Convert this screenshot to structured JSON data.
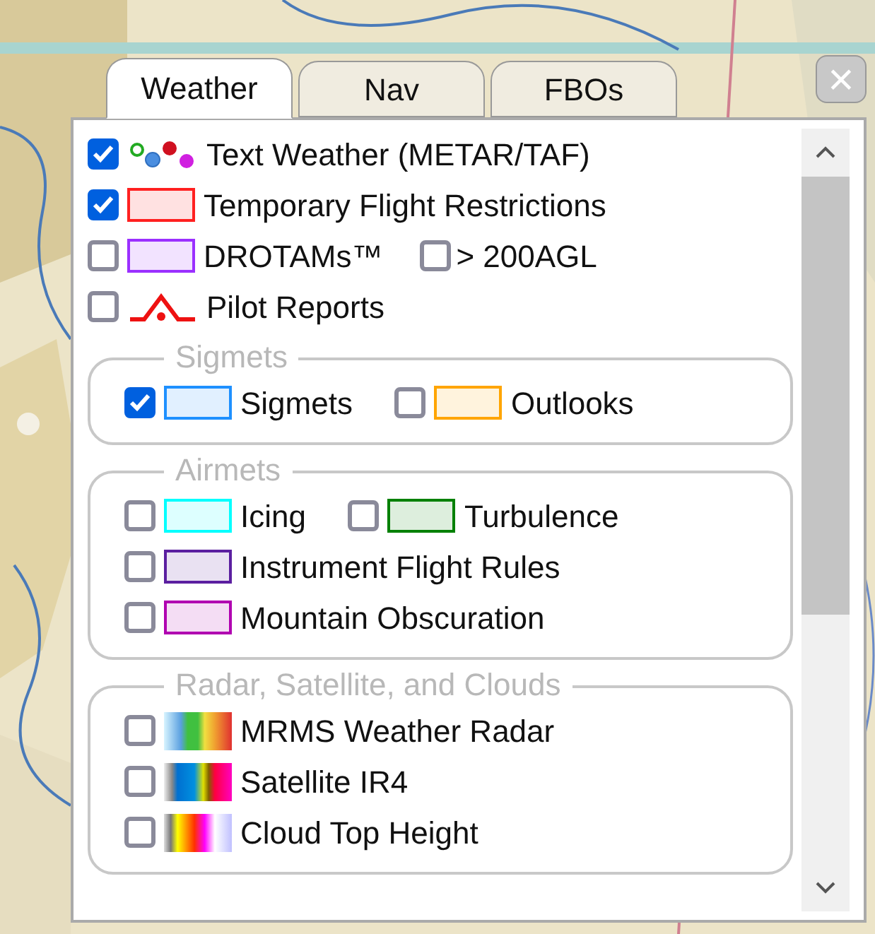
{
  "tabs": [
    {
      "label": "Weather",
      "selected": true
    },
    {
      "label": "Nav",
      "selected": false
    },
    {
      "label": "FBOs",
      "selected": false
    }
  ],
  "close_button": {
    "label": "×"
  },
  "layers": [
    {
      "kind": "dots",
      "label": "Text Weather (METAR/TAF)",
      "checked": true
    },
    {
      "kind": "swatch",
      "label": "Temporary Flight Restrictions",
      "checked": true,
      "color": "#ff2020"
    },
    {
      "kind": "swatch",
      "label": "DROTAMs™",
      "checked": false,
      "color": "#9b30ff",
      "extra": {
        "label": "> 200AGL",
        "checked": false
      }
    },
    {
      "kind": "pirep",
      "label": "Pilot Reports",
      "checked": false
    }
  ],
  "groups": [
    {
      "title": "Sigmets",
      "rows": [
        [
          {
            "kind": "swatch",
            "label": "Sigmets",
            "checked": true,
            "color": "#1e90ff"
          },
          {
            "kind": "swatch",
            "label": "Outlooks",
            "checked": false,
            "color": "#ffa500"
          }
        ]
      ]
    },
    {
      "title": "Airmets",
      "rows": [
        [
          {
            "kind": "swatch",
            "label": "Icing",
            "checked": false,
            "color": "#00ffff"
          },
          {
            "kind": "swatch",
            "label": "Turbulence",
            "checked": false,
            "color": "#008000"
          }
        ],
        [
          {
            "kind": "swatch",
            "label": "Instrument Flight Rules",
            "checked": false,
            "color": "#5b1fa0"
          }
        ],
        [
          {
            "kind": "swatch",
            "label": "Mountain Obscuration",
            "checked": false,
            "color": "#b000b0"
          }
        ]
      ]
    },
    {
      "title": "Radar, Satellite, and Clouds",
      "rows": [
        [
          {
            "kind": "radar",
            "label": "MRMS Weather Radar",
            "checked": false
          }
        ],
        [
          {
            "kind": "satellite",
            "label": "Satellite IR4",
            "checked": false
          }
        ],
        [
          {
            "kind": "cloudtop",
            "label": "Cloud Top Height",
            "checked": false
          }
        ]
      ]
    }
  ]
}
